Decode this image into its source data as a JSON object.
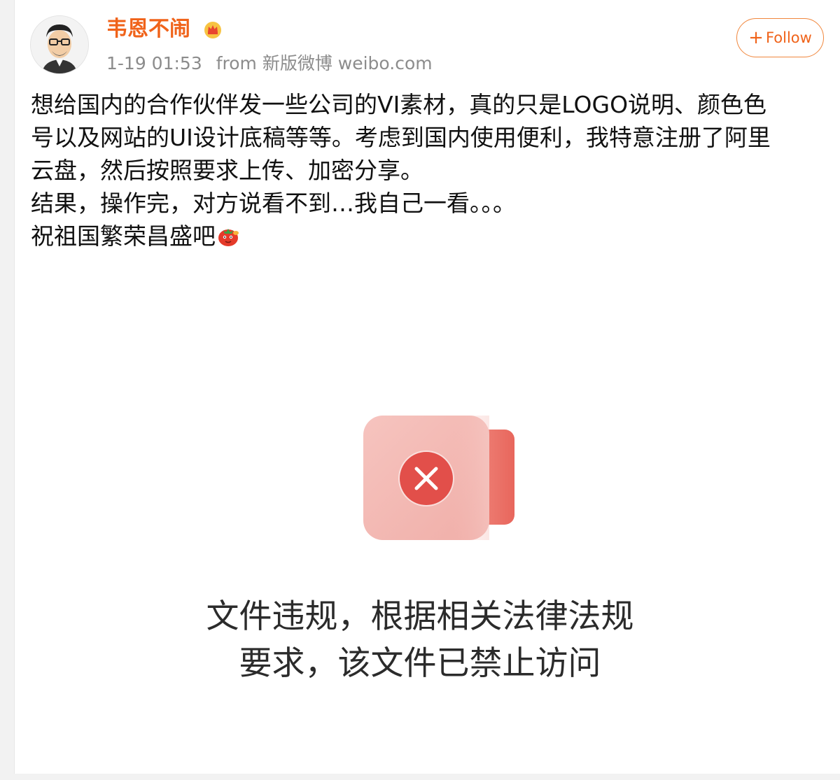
{
  "post": {
    "author": "韦恩不闹",
    "time": "1-19 01:53",
    "source": "from 新版微博 weibo.com",
    "follow_label": "Follow",
    "follow_icon": "+",
    "lines": [
      "想给国内的合作伙伴发一些公司的VI素材，真的只是LOGO说明、颜色色",
      "号以及网站的UI设计底稿等等。考虑到国内使用便利，我特意注册了阿里",
      "云盘，然后按照要求上传、加密分享。",
      "结果，操作完，对方说看不到…我自己一看。。。",
      "祝祖国繁荣昌盛吧"
    ],
    "trailing_emoji": "tomato-emoji",
    "badge_icon": "crown-icon"
  },
  "attachment": {
    "icon": "file-blocked-icon",
    "notice_line1": "文件违规，根据相关法律法规",
    "notice_line2": "要求，该文件已禁止访问"
  },
  "colors": {
    "username": "#f0631a",
    "follow_border": "#f0863c",
    "error_red": "#e24f4a",
    "card_pink": "#f2b6b1"
  }
}
